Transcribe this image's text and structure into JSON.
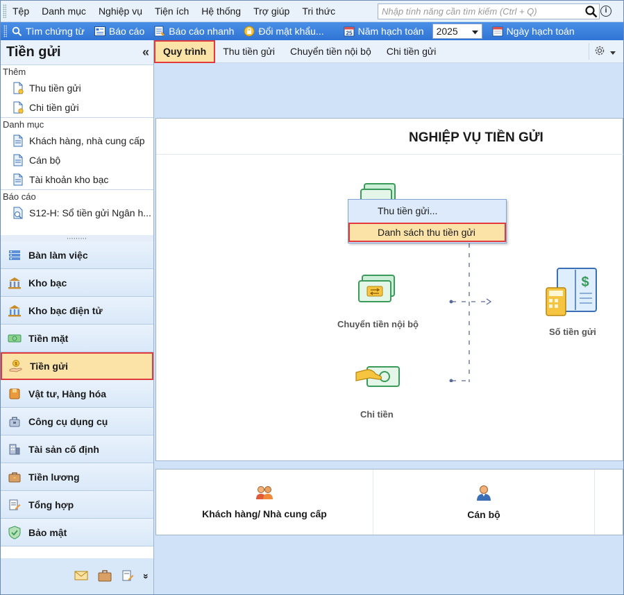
{
  "menubar": {
    "items": [
      "Tệp",
      "Danh mục",
      "Nghiệp vụ",
      "Tiện ích",
      "Hệ thống",
      "Trợ giúp",
      "Tri thức"
    ],
    "search_placeholder": "Nhập tính năng cần tìm kiếm (Ctrl + Q)"
  },
  "toolbar": {
    "find_voucher": "Tìm chứng từ",
    "report": "Báo cáo",
    "quick_report": "Báo cáo nhanh",
    "change_password": "Đổi mật khẩu...",
    "fiscal_year_label": "Năm hạch toán",
    "fiscal_year_value": "2025",
    "posting_date": "Ngày hạch toán"
  },
  "sidebar": {
    "title": "Tiền gửi",
    "collapse": "«",
    "sections": {
      "add": {
        "title": "Thêm",
        "items": [
          "Thu tiền gửi",
          "Chi tiền gửi"
        ]
      },
      "catalog": {
        "title": "Danh mục",
        "items": [
          "Khách hàng, nhà cung cấp",
          "Cán bộ",
          "Tài khoản kho bạc"
        ]
      },
      "reports": {
        "title": "Báo cáo",
        "items": [
          "S12-H: Sổ tiền gửi Ngân h..."
        ]
      }
    },
    "splitter": ",,,,,,,,,",
    "nav": [
      "Bàn làm việc",
      "Kho bạc",
      "Kho bạc điện tử",
      "Tiền mặt",
      "Tiền gửi",
      "Vật tư, Hàng hóa",
      "Công cụ dụng cụ",
      "Tài sản cố định",
      "Tiền lương",
      "Tổng hợp",
      "Bảo mật"
    ],
    "more": "»"
  },
  "tabs": [
    "Quy trình",
    "Thu tiền gửi",
    "Chuyển tiền nội bộ",
    "Chi tiền gửi"
  ],
  "main": {
    "title": "NGHIỆP VỤ TIỀN GỬI",
    "flow": {
      "internal_transfer": "Chuyển tiền nội bộ",
      "payout": "Chi tiền",
      "deposit_book": "Số tiền gửi"
    }
  },
  "context_menu": {
    "items": [
      "Thu tiền gửi...",
      "Danh sách thu tiền gửi"
    ]
  },
  "catalog_panel": {
    "items": [
      "Khách hàng/ Nhà cung cấp",
      "Cán bộ"
    ]
  },
  "colors": {
    "accent_blue": "#2f74d4",
    "highlight": "#fbe3a8",
    "highlight_border": "#e0393e",
    "money_green": "#3a9a5a"
  }
}
